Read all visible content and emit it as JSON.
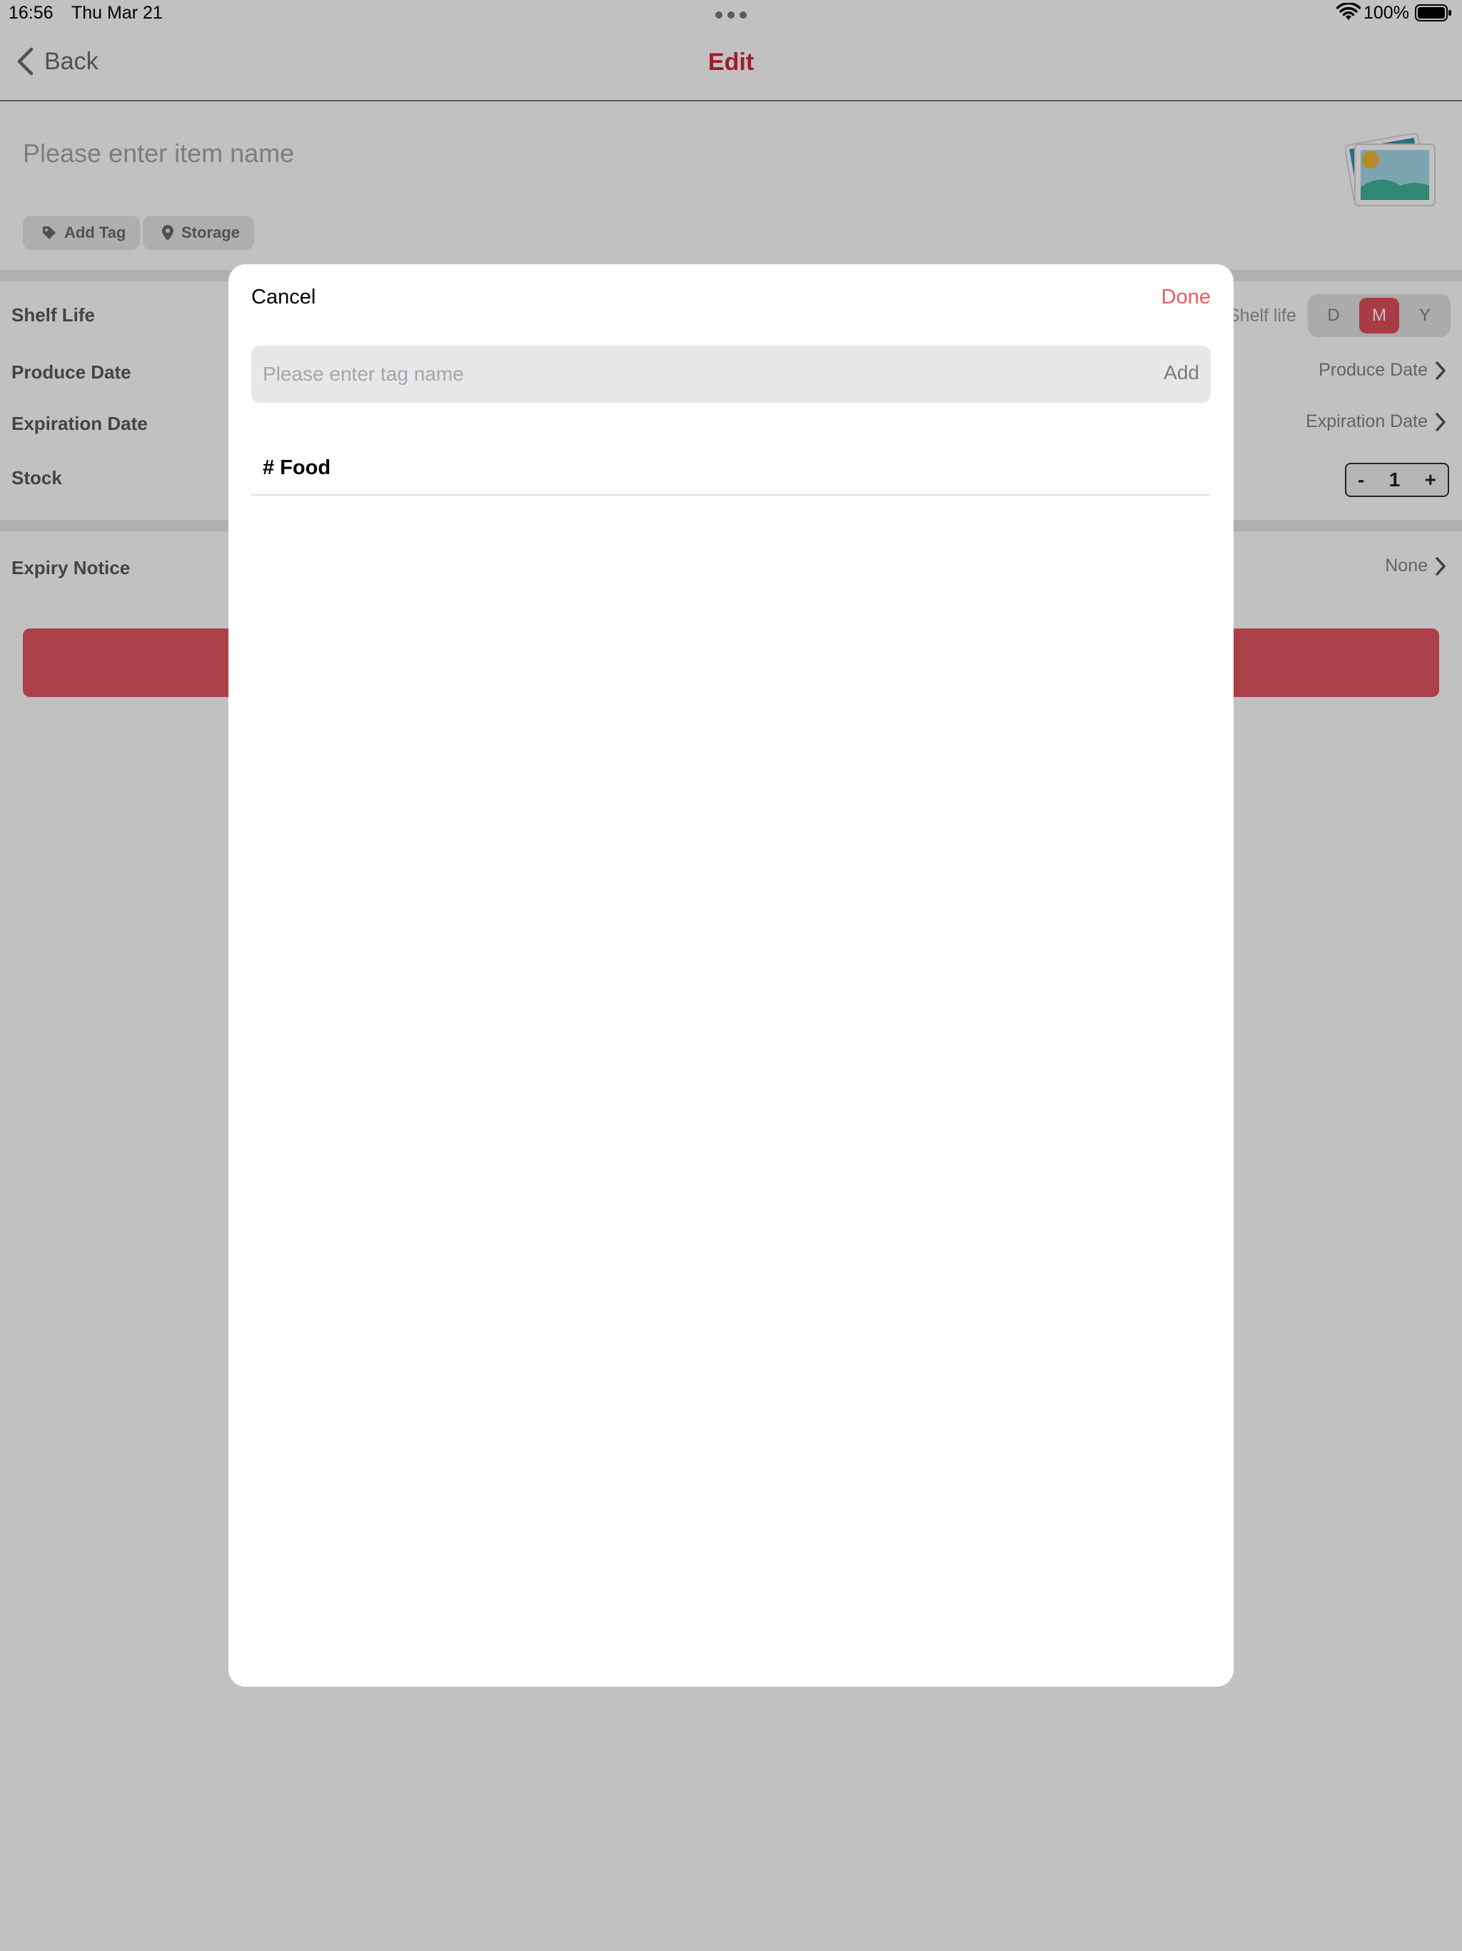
{
  "status_bar": {
    "time": "16:56",
    "date": "Thu Mar 21",
    "battery": "100%"
  },
  "nav": {
    "back_label": "Back",
    "title": "Edit"
  },
  "item": {
    "name_placeholder": "Please enter item name",
    "add_tag_label": "Add Tag",
    "storage_label": "Storage"
  },
  "fields": {
    "shelf_life_label": "Shelf Life",
    "shelf_life_caption": "Shelf life",
    "shelf_life_units": [
      "D",
      "M",
      "Y"
    ],
    "shelf_life_selected": "M",
    "produce_date_label": "Produce Date",
    "produce_date_value": "Produce Date",
    "expiration_date_label": "Expiration Date",
    "expiration_date_value": "Expiration Date",
    "stock_label": "Stock",
    "stock_minus": "-",
    "stock_value": "1",
    "stock_plus": "+",
    "expiry_notice_label": "Expiry Notice",
    "expiry_notice_value": "None"
  },
  "modal": {
    "cancel_label": "Cancel",
    "done_label": "Done",
    "tag_input_placeholder": "Please enter tag name",
    "add_label": "Add",
    "tags": [
      "# Food"
    ]
  },
  "colors": {
    "accent": "#d6243c",
    "done": "#ed5b5c",
    "segment_active": "#e04f5b",
    "save_button": "#e45561"
  }
}
